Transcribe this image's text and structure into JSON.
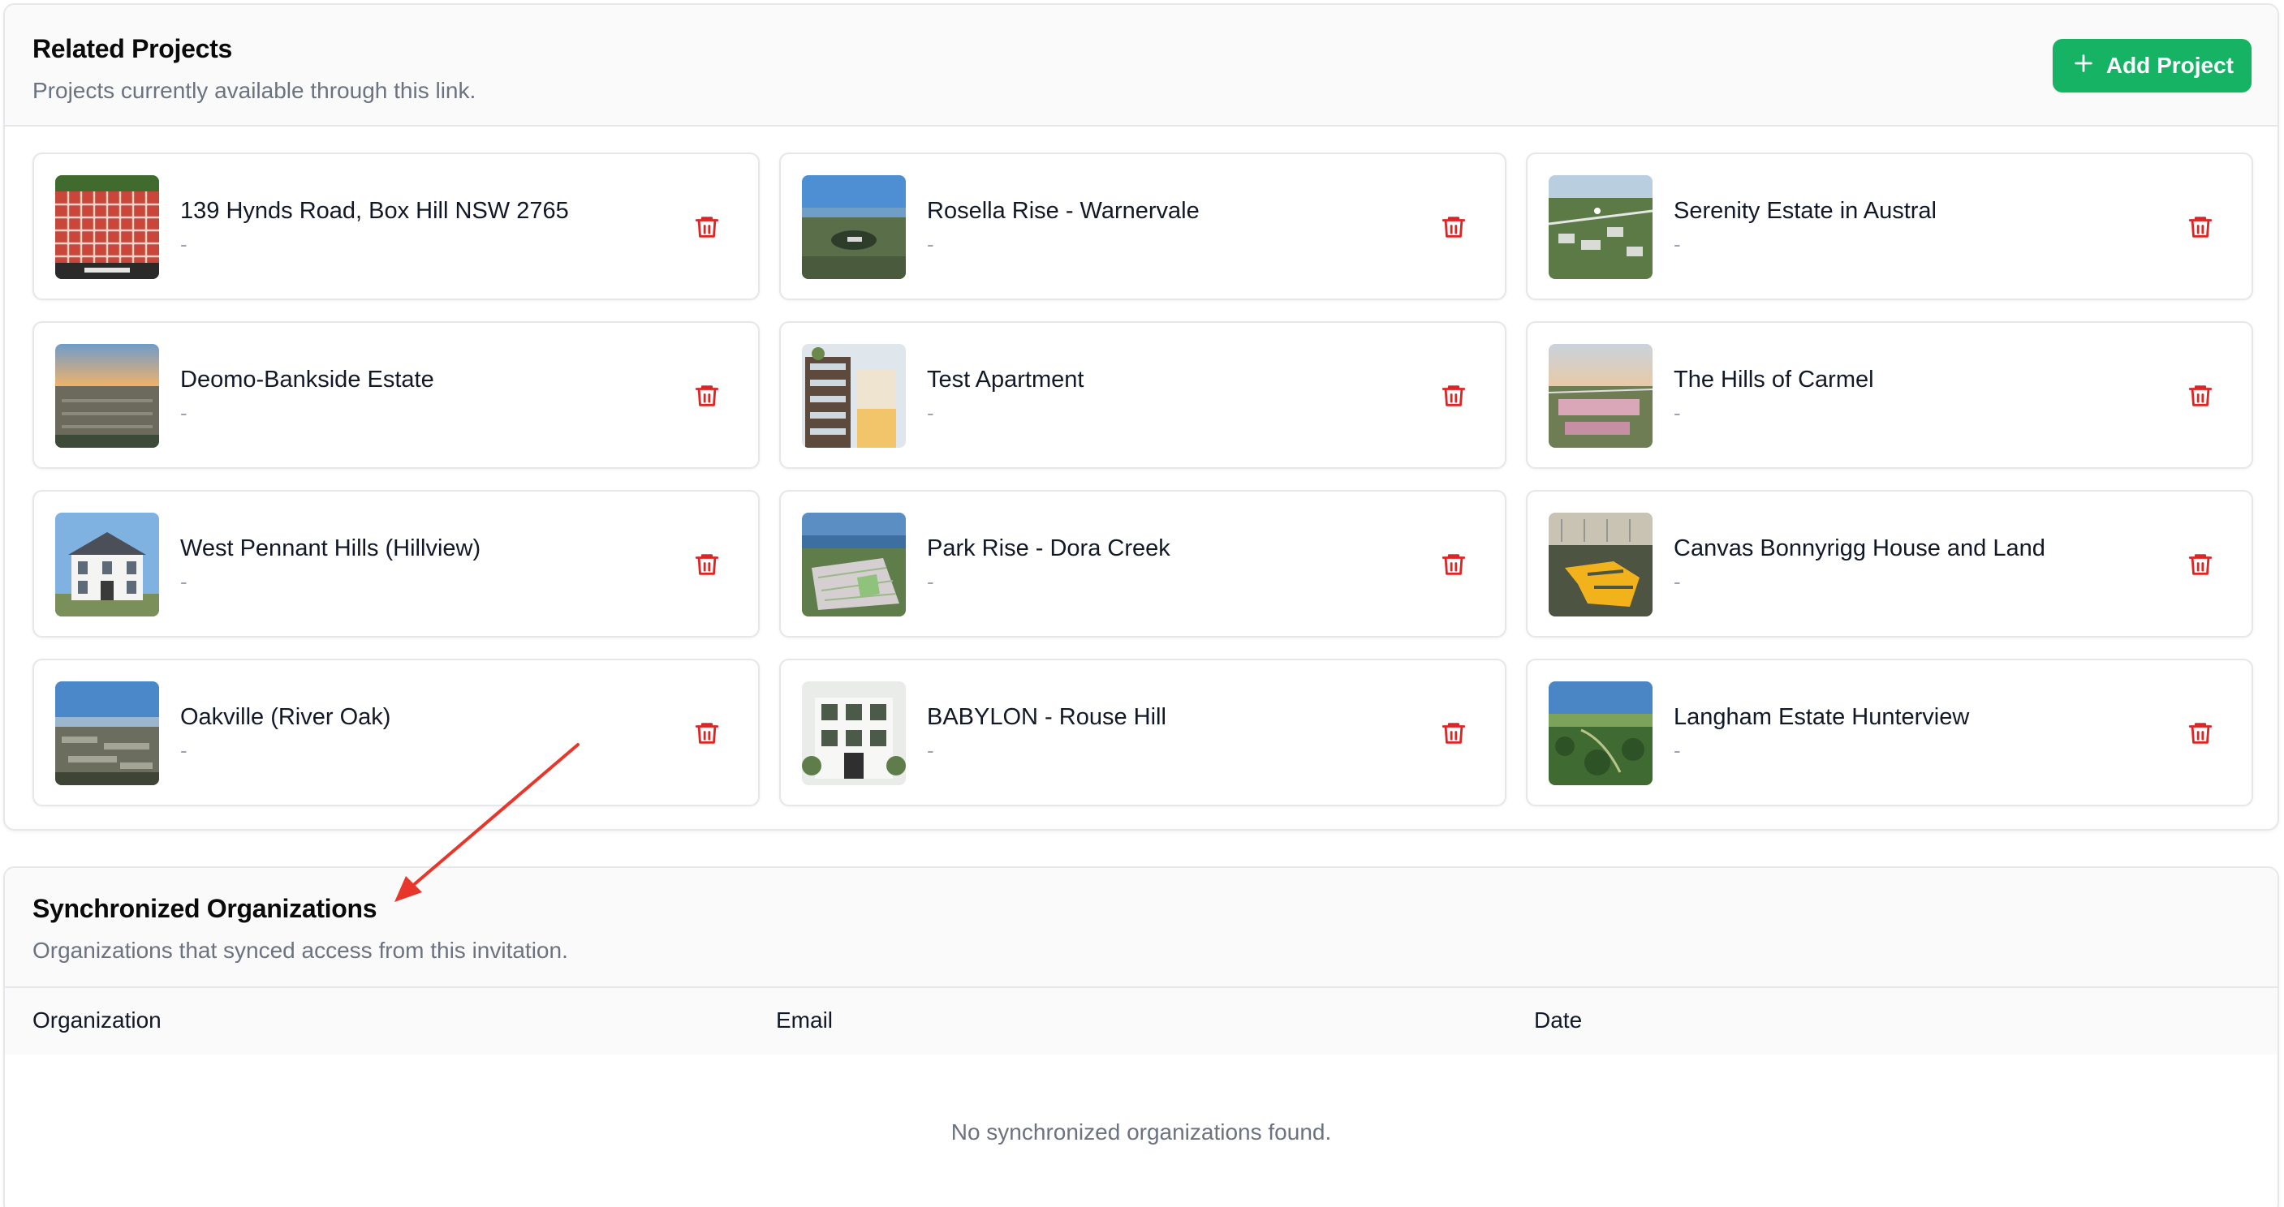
{
  "related": {
    "title": "Related Projects",
    "subtitle": "Projects currently available through this link.",
    "add_label": "Add Project",
    "add_icon": "plus-icon",
    "delete_icon": "trash-icon",
    "projects": [
      {
        "name": "139 Hynds Road, Box Hill NSW 2765",
        "sub": "-"
      },
      {
        "name": "Rosella Rise - Warnervale",
        "sub": "-"
      },
      {
        "name": "Serenity Estate in Austral",
        "sub": "-"
      },
      {
        "name": "Deomo-Bankside Estate",
        "sub": "-"
      },
      {
        "name": "Test Apartment",
        "sub": "-"
      },
      {
        "name": "The Hills of Carmel",
        "sub": "-"
      },
      {
        "name": "West Pennant Hills (Hillview)",
        "sub": "-"
      },
      {
        "name": "Park Rise - Dora Creek",
        "sub": "-"
      },
      {
        "name": "Canvas Bonnyrigg House and Land",
        "sub": "-"
      },
      {
        "name": "Oakville (River Oak)",
        "sub": "-"
      },
      {
        "name": "BABYLON - Rouse Hill",
        "sub": "-"
      },
      {
        "name": "Langham Estate Hunterview",
        "sub": "-"
      }
    ]
  },
  "sync": {
    "title": "Synchronized Organizations",
    "subtitle": "Organizations that synced access from this invitation.",
    "columns": [
      "Organization",
      "Email",
      "Date"
    ],
    "empty_message": "No synchronized organizations found."
  },
  "colors": {
    "accent_green": "#16b364",
    "danger_red": "#dc2626",
    "annotation_arrow": "#e8362a"
  }
}
